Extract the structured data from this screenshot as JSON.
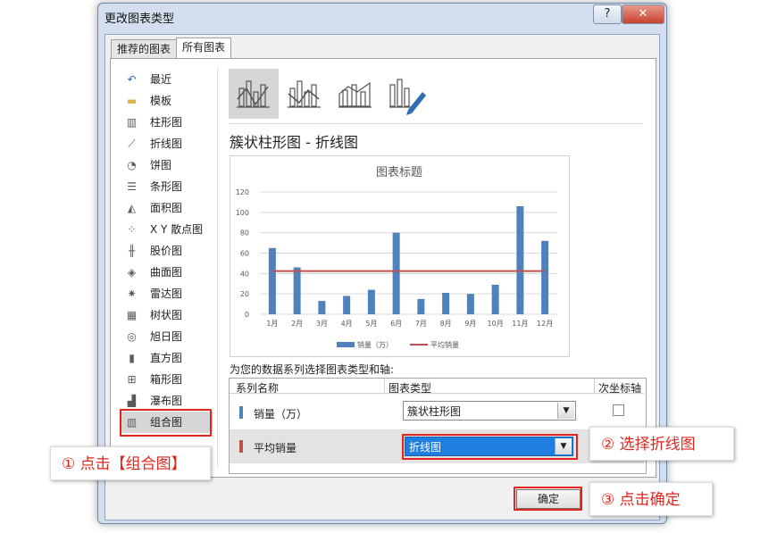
{
  "window": {
    "title": "更改图表类型",
    "help_glyph": "?",
    "close_glyph": "✕"
  },
  "tabs": [
    {
      "label": "推荐的图表",
      "active": false
    },
    {
      "label": "所有图表",
      "active": true
    }
  ],
  "chart_types": [
    {
      "label": "最近",
      "icon": "recent-icon",
      "glyph": "↶"
    },
    {
      "label": "模板",
      "icon": "folder-icon",
      "glyph": "▬"
    },
    {
      "label": "柱形图",
      "icon": "column-chart-icon",
      "glyph": "▥"
    },
    {
      "label": "折线图",
      "icon": "line-chart-icon",
      "glyph": "⟋"
    },
    {
      "label": "饼图",
      "icon": "pie-chart-icon",
      "glyph": "◔"
    },
    {
      "label": "条形图",
      "icon": "bar-chart-icon",
      "glyph": "☰"
    },
    {
      "label": "面积图",
      "icon": "area-chart-icon",
      "glyph": "◭"
    },
    {
      "label": "X Y 散点图",
      "icon": "scatter-chart-icon",
      "glyph": "⁘"
    },
    {
      "label": "股价图",
      "icon": "stock-chart-icon",
      "glyph": "╫"
    },
    {
      "label": "曲面图",
      "icon": "surface-chart-icon",
      "glyph": "◈"
    },
    {
      "label": "雷达图",
      "icon": "radar-chart-icon",
      "glyph": "✷"
    },
    {
      "label": "树状图",
      "icon": "treemap-chart-icon",
      "glyph": "▦"
    },
    {
      "label": "旭日图",
      "icon": "sunburst-chart-icon",
      "glyph": "◎"
    },
    {
      "label": "直方图",
      "icon": "histogram-chart-icon",
      "glyph": "▮"
    },
    {
      "label": "箱形图",
      "icon": "boxplot-chart-icon",
      "glyph": "⊞"
    },
    {
      "label": "瀑布图",
      "icon": "waterfall-chart-icon",
      "glyph": "▟"
    },
    {
      "label": "组合图",
      "icon": "combo-chart-icon",
      "glyph": "▥",
      "selected": true
    }
  ],
  "subtype_title": "簇状柱形图 - 折线图",
  "chart_data": {
    "type": "bar",
    "title": "图表标题",
    "categories": [
      "1月",
      "2月",
      "3月",
      "4月",
      "5月",
      "6月",
      "7月",
      "8月",
      "9月",
      "10月",
      "11月",
      "12月"
    ],
    "series": [
      {
        "name": "销量（万）",
        "type": "bar",
        "color": "#4f81bd",
        "values": [
          65,
          46,
          13,
          18,
          24,
          80,
          15,
          21,
          20,
          29,
          106,
          72
        ]
      },
      {
        "name": "平均销量",
        "type": "line",
        "color": "#c0504d",
        "values": [
          42.4,
          42.4,
          42.4,
          42.4,
          42.4,
          42.4,
          42.4,
          42.4,
          42.4,
          42.4,
          42.4,
          42.4
        ]
      }
    ],
    "ylim": [
      0,
      120
    ],
    "yticks": [
      "0",
      "20",
      "40",
      "60",
      "80",
      "100",
      "120"
    ],
    "grid": true,
    "legend": "bottom"
  },
  "series_section": {
    "prompt": "为您的数据系列选择图表类型和轴:",
    "col_name": "系列名称",
    "col_type": "图表类型",
    "col_axis": "次坐标轴",
    "rows": [
      {
        "name": "销量（万）",
        "type": "簇状柱形图",
        "color": "#4f81bd"
      },
      {
        "name": "平均销量",
        "type": "折线图",
        "color": "#c0504d"
      }
    ]
  },
  "ok_label": "确定",
  "callouts": {
    "c1": "① 点击【组合图】",
    "c2": "② 选择折线图",
    "c3": "③ 点击确定"
  },
  "colors": {
    "accent_red": "#e0251e",
    "bar_blue": "#4f81bd",
    "line_red": "#c0504d",
    "select_blue": "#1e7fe0"
  }
}
